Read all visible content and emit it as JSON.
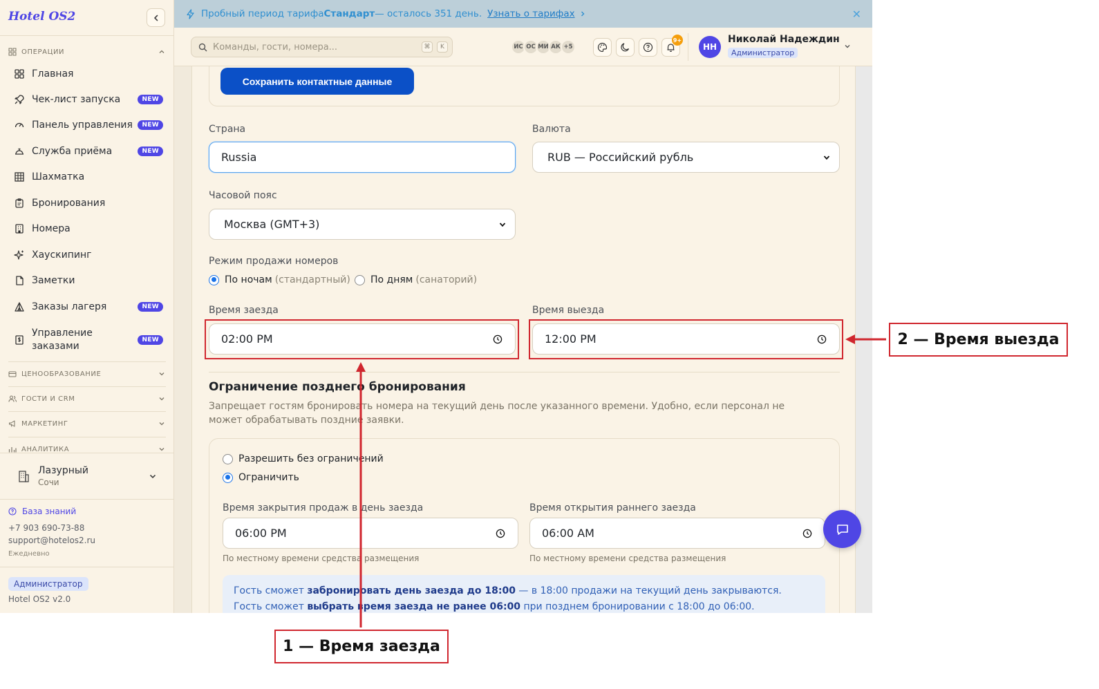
{
  "app": {
    "brand": "Hotel OS2"
  },
  "trial_banner": {
    "prefix": "Пробный период тарифа ",
    "plan": "Стандарт",
    "suffix": " — осталось 351 день.",
    "link": "Узнать о тарифах",
    "close_icon": "close-icon"
  },
  "search": {
    "placeholder": "Команды, гости, номера...",
    "shortcut_mod": "⌘",
    "shortcut_key": "K"
  },
  "online_users": [
    "ИС",
    "ОС",
    "МИ",
    "АК"
  ],
  "online_more": "+5",
  "notifications_count": "9+",
  "user": {
    "initials": "НН",
    "name": "Николай Надеждин",
    "role": "Администратор"
  },
  "sidebar": {
    "section_operations": "ОПЕРАЦИИ",
    "items": [
      {
        "label": "Главная",
        "icon": "grid-icon",
        "badge": ""
      },
      {
        "label": "Чек-лист запуска",
        "icon": "rocket-icon",
        "badge": "NEW"
      },
      {
        "label": "Панель управления",
        "icon": "gauge-icon",
        "badge": "NEW"
      },
      {
        "label": "Служба приёма",
        "icon": "bell-desk-icon",
        "badge": "NEW"
      },
      {
        "label": "Шахматка",
        "icon": "table-grid-icon",
        "badge": ""
      },
      {
        "label": "Бронирования",
        "icon": "clipboard-icon",
        "badge": ""
      },
      {
        "label": "Номера",
        "icon": "building-icon",
        "badge": ""
      },
      {
        "label": "Хаускипинг",
        "icon": "sparkles-icon",
        "badge": ""
      },
      {
        "label": "Заметки",
        "icon": "file-icon",
        "badge": ""
      },
      {
        "label": "Заказы лагеря",
        "icon": "tent-icon",
        "badge": "NEW"
      },
      {
        "label": "Управление заказами",
        "icon": "receipt-icon",
        "badge": "NEW"
      }
    ],
    "sections_collapsed": [
      "ЦЕНООБРАЗОВАНИЕ",
      "ГОСТИ И CRM",
      "МАРКЕТИНГ",
      "АНАЛИТИКА"
    ],
    "hotel": {
      "name": "Лазурный",
      "city": "Сочи"
    },
    "kb_link": "База знаний",
    "phone": "+7 903 690-73-88",
    "email": "support@hotelos2.ru",
    "schedule": "Ежедневно",
    "role": "Администратор",
    "version": "Hotel OS2 v2.0"
  },
  "form": {
    "save_contacts_button": "Сохранить контактные данные",
    "country_label": "Страна",
    "country_value": "Russia",
    "currency_label": "Валюта",
    "currency_value": "RUB — Российский рубль",
    "timezone_label": "Часовой пояс",
    "timezone_value": "Москва (GMT+3)",
    "sale_mode_label": "Режим продажи номеров",
    "sale_mode_nights": "По ночам",
    "sale_mode_nights_hint": "(стандартный)",
    "sale_mode_days": "По дням",
    "sale_mode_days_hint": "(санаторий)",
    "sale_mode_selected": "nights",
    "checkin_label": "Время заезда",
    "checkin_value": "02:00 PM",
    "checkout_label": "Время выезда",
    "checkout_value": "12:00 PM"
  },
  "late_booking": {
    "title": "Ограничение позднего бронирования",
    "description": "Запрещает гостям бронировать номера на текущий день после указанного времени. Удобно, если персонал не может обрабатывать поздние заявки.",
    "option_allow": "Разрешить без ограничений",
    "option_limit": "Ограничить",
    "selected": "limit",
    "close_sales_label": "Время закрытия продаж в день заезда",
    "close_sales_value": "06:00 PM",
    "early_checkin_label": "Время открытия раннего заезда",
    "early_checkin_value": "06:00 AM",
    "local_time_note": "По местному времени средства размещения",
    "info_line1_a": "Гость сможет ",
    "info_line1_b": "забронировать день заезда до 18:00",
    "info_line1_c": " — в 18:00 продажи на текущий день закрываются.",
    "info_line2_a": "Гость сможет ",
    "info_line2_b": "выбрать время заезда не ранее 06:00",
    "info_line2_c": " при позднем бронировании с 18:00 до 06:00."
  },
  "annotations": {
    "callout_1": "1 — Время заезда",
    "callout_2": "2 — Время выезда",
    "color": "#d0262e"
  },
  "colors": {
    "accent": "#4f46e5",
    "primary_button": "#0b50c7",
    "banner_bg": "#bccfd9",
    "page_bg": "#faf3e6"
  }
}
